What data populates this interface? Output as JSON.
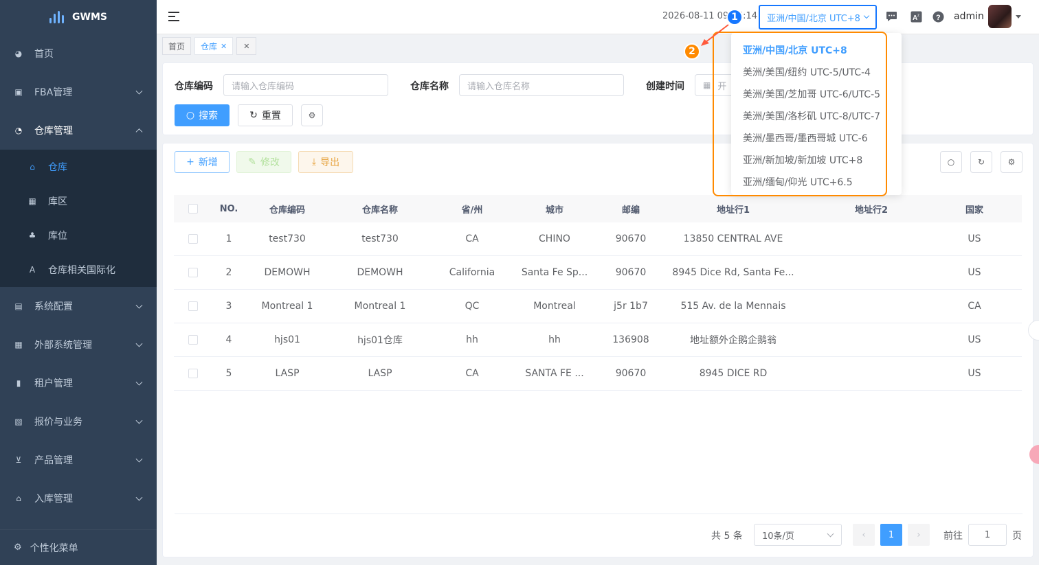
{
  "app": {
    "name": "GWMS"
  },
  "sidebar": {
    "items": [
      {
        "label": "首页",
        "icon": "dashboard-icon"
      },
      {
        "label": "FBA管理",
        "icon": "id-card-icon"
      },
      {
        "label": "仓库管理",
        "icon": "globe-icon"
      },
      {
        "label": "系统配置",
        "icon": "server-icon"
      },
      {
        "label": "外部系统管理",
        "icon": "grid-icon"
      },
      {
        "label": "租户管理",
        "icon": "bar-chart-icon"
      },
      {
        "label": "报价与业务",
        "icon": "calculator-icon"
      },
      {
        "label": "产品管理",
        "icon": "cart-icon"
      },
      {
        "label": "入库管理",
        "icon": "home-icon"
      }
    ],
    "submenu": [
      {
        "label": "仓库",
        "icon": "building-icon"
      },
      {
        "label": "库区",
        "icon": "grid-icon"
      },
      {
        "label": "库位",
        "icon": "tree-icon"
      },
      {
        "label": "仓库相关国际化",
        "icon": "translate-icon"
      }
    ],
    "footer": "个性化菜单"
  },
  "header": {
    "datetime": "2026-08-11 09:44:14",
    "timezone": "亚洲/中国/北京 UTC+8",
    "user": "admin"
  },
  "tags": [
    {
      "label": "首页"
    },
    {
      "label": "仓库"
    }
  ],
  "search": {
    "code_label": "仓库编码",
    "code_placeholder": "请输入仓库编码",
    "name_label": "仓库名称",
    "name_placeholder": "请输入仓库名称",
    "time_label": "创建时间",
    "time_placeholder": "开",
    "search_btn": "搜索",
    "reset_btn": "重置"
  },
  "toolbar": {
    "add": "新增",
    "edit": "修改",
    "export": "导出"
  },
  "table": {
    "columns": [
      "NO.",
      "仓库编码",
      "仓库名称",
      "省/州",
      "城市",
      "邮编",
      "地址行1",
      "地址行2",
      "国家"
    ],
    "rows": [
      [
        "1",
        "test730",
        "test730",
        "CA",
        "CHINO",
        "90670",
        "13850 CENTRAL AVE",
        "",
        "US"
      ],
      [
        "2",
        "DEMOWH",
        "DEMOWH",
        "California",
        "Santa Fe Sp...",
        "90670",
        "8945 Dice Rd, Santa Fe...",
        "",
        "US"
      ],
      [
        "3",
        "Montreal 1",
        "Montreal 1",
        "QC",
        "Montreal",
        "j5r 1b7",
        "515 Av. de la Mennais",
        "",
        "CA"
      ],
      [
        "4",
        "hjs01",
        "hjs01仓库",
        "hh",
        "hh",
        "136908",
        "地址额外企鹅企鹅翁",
        "",
        "US"
      ],
      [
        "5",
        "LASP",
        "LASP",
        "CA",
        "SANTA FE ...",
        "90670",
        "8945 DICE RD",
        "",
        "US"
      ]
    ]
  },
  "pagination": {
    "total": "共 5 条",
    "page_size": "10条/页",
    "current": "1",
    "goto_label": "前往",
    "goto_value": "1",
    "page_suffix": "页"
  },
  "timezone_dropdown": {
    "options": [
      "亚洲/中国/北京 UTC+8",
      "美洲/美国/纽约 UTC-5/UTC-4",
      "美洲/美国/芝加哥 UTC-6/UTC-5",
      "美洲/美国/洛杉矶 UTC-8/UTC-7",
      "美洲/墨西哥/墨西哥城 UTC-6",
      "亚洲/新加坡/新加坡 UTC+8",
      "亚洲/缅甸/仰光 UTC+6.5"
    ],
    "selected_index": 0
  },
  "annotations": {
    "badge1": "1",
    "badge2": "2"
  },
  "colors": {
    "primary": "#409eff",
    "sidebar": "#304156",
    "highlight": "#ff8a00",
    "callout": "#1677ff"
  }
}
